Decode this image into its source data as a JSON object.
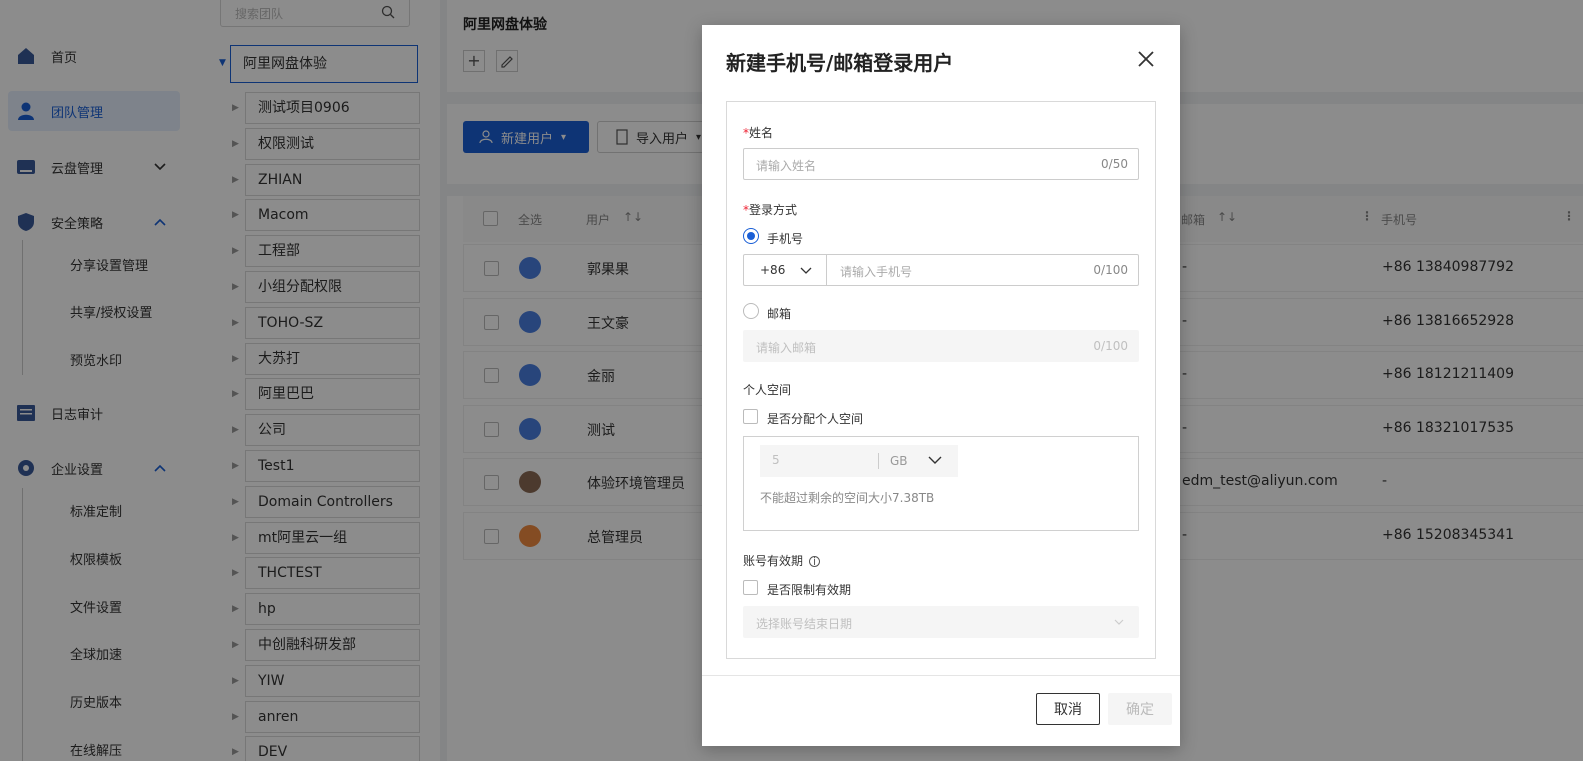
{
  "nav": {
    "items": [
      {
        "label": "首页",
        "icon": "home-icon"
      },
      {
        "label": "团队管理",
        "icon": "user-icon"
      },
      {
        "label": "云盘管理",
        "icon": "drive-icon"
      },
      {
        "label": "安全策略",
        "icon": "shield-icon"
      },
      {
        "label": "日志审计",
        "icon": "log-icon"
      },
      {
        "label": "企业设置",
        "icon": "gear-icon"
      }
    ],
    "security_sub": [
      "分享设置管理",
      "共享/授权设置",
      "预览水印"
    ],
    "enterprise_sub": [
      "标准定制",
      "权限模板",
      "文件设置",
      "全球加速",
      "历史版本",
      "在线解压"
    ]
  },
  "tree": {
    "search_placeholder": "搜索团队",
    "root": "阿里网盘体验",
    "children": [
      "测试项目0906",
      "权限测试",
      "ZHIAN",
      "Macom",
      "工程部",
      "小组分配权限",
      "TOHO-SZ",
      "大苏打",
      "阿里巴巴",
      "公司",
      "Test1",
      "Domain Controllers",
      "mt阿里云一组",
      "THCTEST",
      "hp",
      "中创融科研发部",
      "YIW",
      "anren",
      "DEV"
    ]
  },
  "main": {
    "team_title": "阿里网盘体验",
    "new_user_label": "新建用户",
    "import_user_label": "导入用户",
    "table_headers": {
      "select_all": "全选",
      "user": "用户",
      "email": "邮箱",
      "phone": "手机号"
    },
    "rows": [
      {
        "name": "郭果果",
        "email": "-",
        "phone": "+86 13840987792"
      },
      {
        "name": "王文豪",
        "email": "-",
        "phone": "+86 13816652928"
      },
      {
        "name": "金丽",
        "email": "-",
        "phone": "+86 18121211409"
      },
      {
        "name": "测试",
        "email": "-",
        "phone": "+86 18321017535"
      },
      {
        "name": "体验环境管理员",
        "email": "edm_test@aliyun.com",
        "phone": "-"
      },
      {
        "name": "总管理员",
        "email": "-",
        "phone": "+86 15208345341"
      }
    ]
  },
  "modal": {
    "title": "新建手机号/邮箱登录用户",
    "name_label": "姓名",
    "name_placeholder": "请输入姓名",
    "name_count": "0/50",
    "login_label": "登录方式",
    "phone_option": "手机号",
    "country_code": "+86",
    "phone_placeholder": "请输入手机号",
    "phone_count": "0/100",
    "email_option": "邮箱",
    "email_placeholder": "请输入邮箱",
    "email_count": "0/100",
    "space_label": "个人空间",
    "space_checkbox": "是否分配个人空间",
    "space_value": "5",
    "space_unit": "GB",
    "space_hint": "不能超过剩余的空间大小7.38TB",
    "validity_label": "账号有效期",
    "validity_checkbox": "是否限制有效期",
    "date_placeholder": "选择账号结束日期",
    "cancel": "取消",
    "confirm": "确定"
  }
}
